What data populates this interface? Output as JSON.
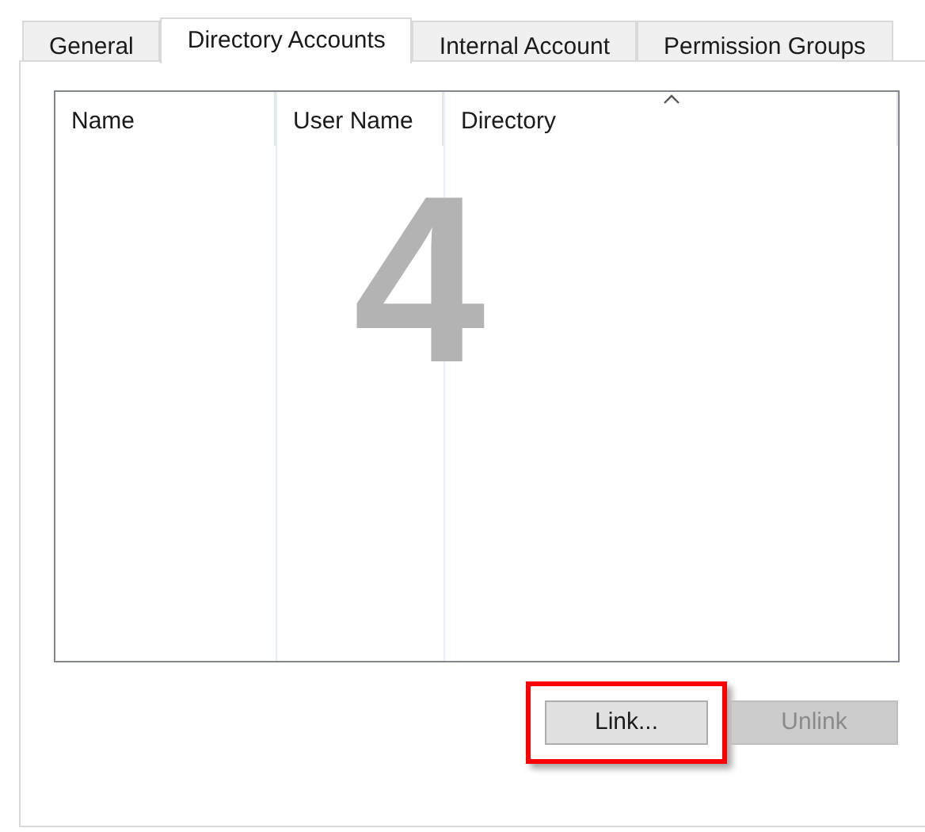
{
  "tabs": [
    {
      "label": "General",
      "selected": false
    },
    {
      "label": "Directory Accounts",
      "selected": true
    },
    {
      "label": "Internal Account",
      "selected": false
    },
    {
      "label": "Permission Groups",
      "selected": false
    }
  ],
  "table": {
    "columns": [
      {
        "label": "Name",
        "sorted": false
      },
      {
        "label": "User Name",
        "sorted": false
      },
      {
        "label": "Directory",
        "sorted": true
      }
    ]
  },
  "callout": {
    "number": "4"
  },
  "buttons": [
    {
      "label": "Link...",
      "disabled": false,
      "highlighted": true
    },
    {
      "label": "Unlink",
      "disabled": true,
      "highlighted": false
    }
  ]
}
